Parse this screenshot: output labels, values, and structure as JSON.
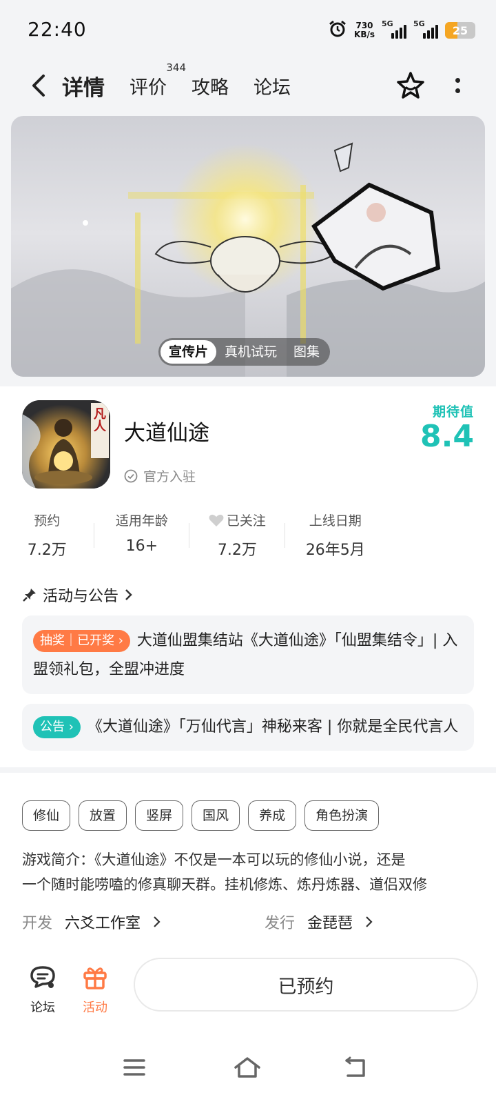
{
  "status": {
    "time": "22:40",
    "speed_value": "730",
    "speed_unit": "KB/s",
    "signal1": "5G",
    "signal2": "5G",
    "battery": "25"
  },
  "header": {
    "tabs": [
      {
        "label": "详情"
      },
      {
        "label": "评价",
        "count": "344"
      },
      {
        "label": "攻略"
      },
      {
        "label": "论坛"
      }
    ]
  },
  "media": {
    "tabs": [
      "宣传片",
      "真机试玩",
      "图集"
    ]
  },
  "app": {
    "name": "大道仙途",
    "official": "官方入驻",
    "rating_label": "期待值",
    "rating_value": "8.4",
    "icon_text": "凡人"
  },
  "stats": [
    {
      "label": "预约",
      "value": "7.2万"
    },
    {
      "label": "适用年龄",
      "value": "16+"
    },
    {
      "label": "已关注",
      "value": "7.2万"
    },
    {
      "label": "上线日期",
      "value": "26年5月"
    }
  ],
  "activities": {
    "title": "活动与公告",
    "items": [
      {
        "badge": "抽奖｜已开奖",
        "text": "大道仙盟集结站《大道仙途》「仙盟集结令」| 入盟领礼包，全盟冲进度"
      },
      {
        "badge": "公告",
        "text": "《大道仙途》「万仙代言」神秘来客 | 你就是全民代言人"
      }
    ]
  },
  "tags": [
    "修仙",
    "放置",
    "竖屏",
    "国风",
    "养成",
    "角色扮演"
  ],
  "description": {
    "line1": "游戏简介：《大道仙途》不仅是一本可以玩的修仙小说，还是",
    "line2": "一个随时能唠嗑的修真聊天群。挂机修炼、炼丹炼器、道侣双修"
  },
  "developer": {
    "label": "开发",
    "value": "六爻工作室"
  },
  "publisher": {
    "label": "发行",
    "value": "金琵琶"
  },
  "bottom": {
    "forum_label": "论坛",
    "activity_label": "活动",
    "reserve_label": "已预约"
  },
  "colors": {
    "accent": "#1fc2b6",
    "orange": "#ff7a45"
  }
}
